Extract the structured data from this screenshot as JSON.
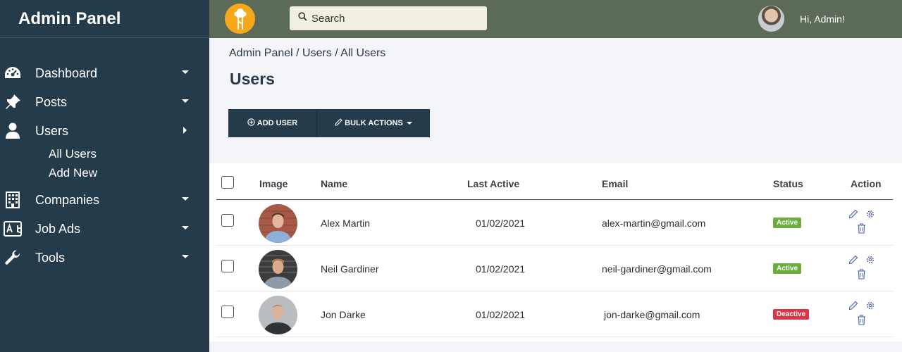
{
  "sidebar": {
    "brand": "Admin Panel",
    "items": [
      {
        "label": "Dashboard",
        "icon": "dashboard-icon"
      },
      {
        "label": "Posts",
        "icon": "pin-icon"
      },
      {
        "label": "Users",
        "icon": "user-icon",
        "submenu": [
          "All Users",
          "Add New"
        ]
      },
      {
        "label": "Companies",
        "icon": "building-icon"
      },
      {
        "label": "Job Ads",
        "icon": "ad-icon"
      },
      {
        "label": "Tools",
        "icon": "wrench-icon"
      }
    ]
  },
  "topbar": {
    "search_placeholder": "Search",
    "greeting": "Hi, Admin!"
  },
  "breadcrumb": "Admin Panel / Users / All Users",
  "page_title": "Users",
  "actions": {
    "add_user": "ADD USER",
    "bulk_actions": "BULK ACTIONS"
  },
  "table": {
    "columns": [
      "Image",
      "Name",
      "Last Active",
      "Email",
      "Status",
      "Action"
    ],
    "rows": [
      {
        "name": "Alex Martin",
        "last_active": "01/02/2021",
        "email": "alex-martin@gmail.com",
        "status": "Active"
      },
      {
        "name": "Neil Gardiner",
        "last_active": "01/02/2021",
        "email": "neil-gardiner@gmail.com",
        "status": "Active"
      },
      {
        "name": "Jon Darke",
        "last_active": "01/02/2021",
        "email": "jon-darke@gmail.com",
        "status": "Deactive"
      }
    ]
  },
  "colors": {
    "sidebar": "#243b4b",
    "topbar": "#5b6b58",
    "logo": "#f6a81a",
    "active": "#6cae3e",
    "deactive": "#dc3545",
    "action_icons": "#4a5fa8"
  }
}
